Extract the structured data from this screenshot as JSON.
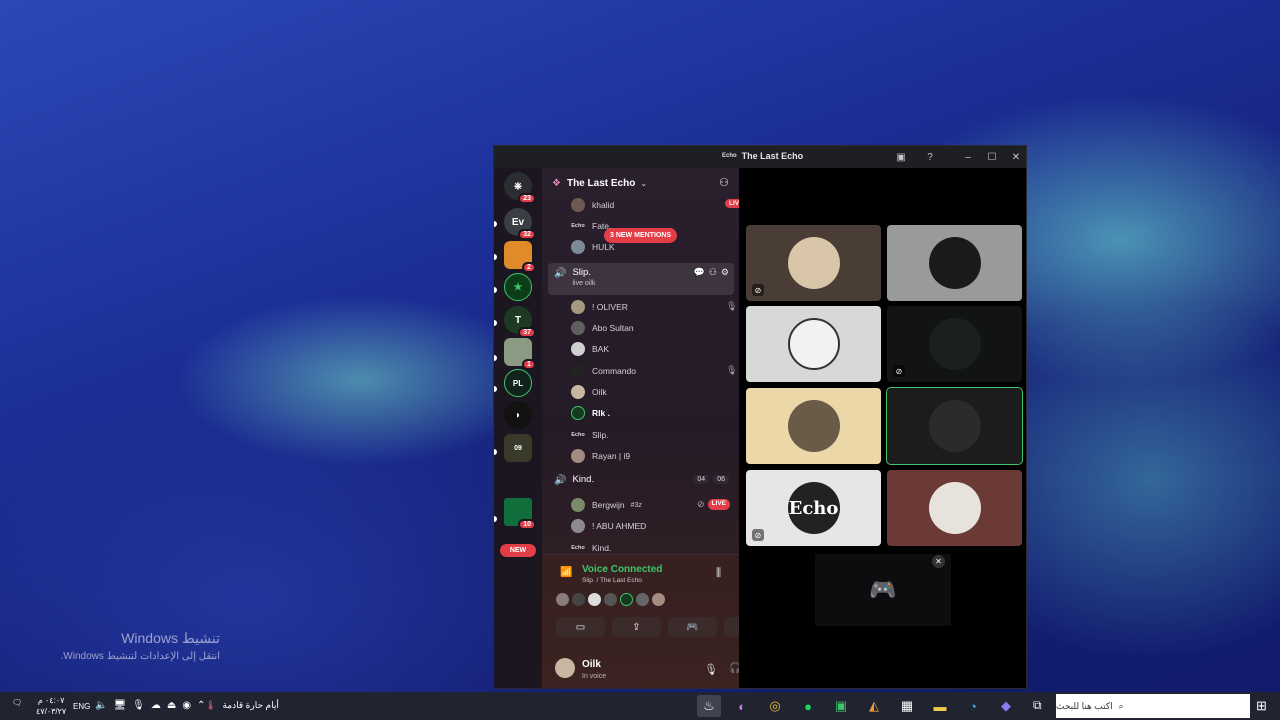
{
  "desktop": {
    "watermark_title": "تنشيط Windows",
    "watermark_sub": "انتقل إلى الإعدادات لتنشيط Windows."
  },
  "window": {
    "title": "The Last Echo",
    "logo_text": "Echo"
  },
  "rail": {
    "servers": [
      {
        "name": "discord-home",
        "badge": "23",
        "color": "#2b2d31",
        "label": "⎈"
      },
      {
        "name": "server-ev",
        "badge": "32",
        "color": "#3a3d44",
        "label": "Ev"
      },
      {
        "name": "server-orange",
        "badge": "2",
        "color": "#e08a2a",
        "label": ""
      },
      {
        "name": "server-green-star",
        "badge": "",
        "color": "#0c3d18",
        "label": "★"
      },
      {
        "name": "server-t",
        "badge": "37",
        "color": "#1f3a22",
        "label": "T"
      },
      {
        "name": "server-photo",
        "badge": "1",
        "color": "#8b9a82",
        "label": ""
      },
      {
        "name": "server-pl",
        "badge": "",
        "color": "#10241c",
        "label": "PL"
      },
      {
        "name": "server-dark-shield",
        "badge": "",
        "color": "#121212",
        "label": "◗"
      },
      {
        "name": "server-09hq",
        "badge": "",
        "color": "#3a3a2a",
        "label": "09"
      },
      {
        "name": "server-flag",
        "badge": "10",
        "color": "#0f6e3a",
        "label": ""
      }
    ],
    "new_label": "NEW"
  },
  "channels": {
    "server_name": "The Last Echo",
    "mentions_label": "3 NEW MENTIONS",
    "top_members": [
      {
        "name": "khalid",
        "live": "LIVE"
      },
      {
        "name": "Fate.",
        "live": ""
      },
      {
        "name": "HULK",
        "live": ""
      }
    ],
    "active_channel": {
      "name": "Slip.",
      "sub": "live oilk"
    },
    "members": [
      {
        "name": "! OLIVER"
      },
      {
        "name": "Abo Sultan"
      },
      {
        "name": "BAK"
      },
      {
        "name": "Commando"
      },
      {
        "name": "Oilk"
      },
      {
        "name": "Rlk ."
      },
      {
        "name": "Slip."
      },
      {
        "name": "Rayan | i9"
      }
    ],
    "second_channel": {
      "name": "Kind.",
      "count_a": "04",
      "count_b": "06"
    },
    "second_members": [
      {
        "name": "Bergwijn",
        "tag": "#3z",
        "live": "LIVE"
      },
      {
        "name": "! ABU AHMED",
        "tag": "",
        "live": ""
      },
      {
        "name": "Kind.",
        "tag": "",
        "live": ""
      }
    ]
  },
  "voice": {
    "status": "Voice Connected",
    "location": "Slip. / The Last Echo"
  },
  "user": {
    "name": "Oilk",
    "status": "In voice"
  },
  "taskbar": {
    "time": "٠٤:٠٧ م",
    "date": "٤٧/٠٣/٢٧",
    "lang": "ENG",
    "weather": "أيام حارة قادمة",
    "search_placeholder": "اكتب هنا للبحث"
  },
  "colors": {
    "accent_green": "#3ec56b",
    "live_red": "#e33d47"
  }
}
